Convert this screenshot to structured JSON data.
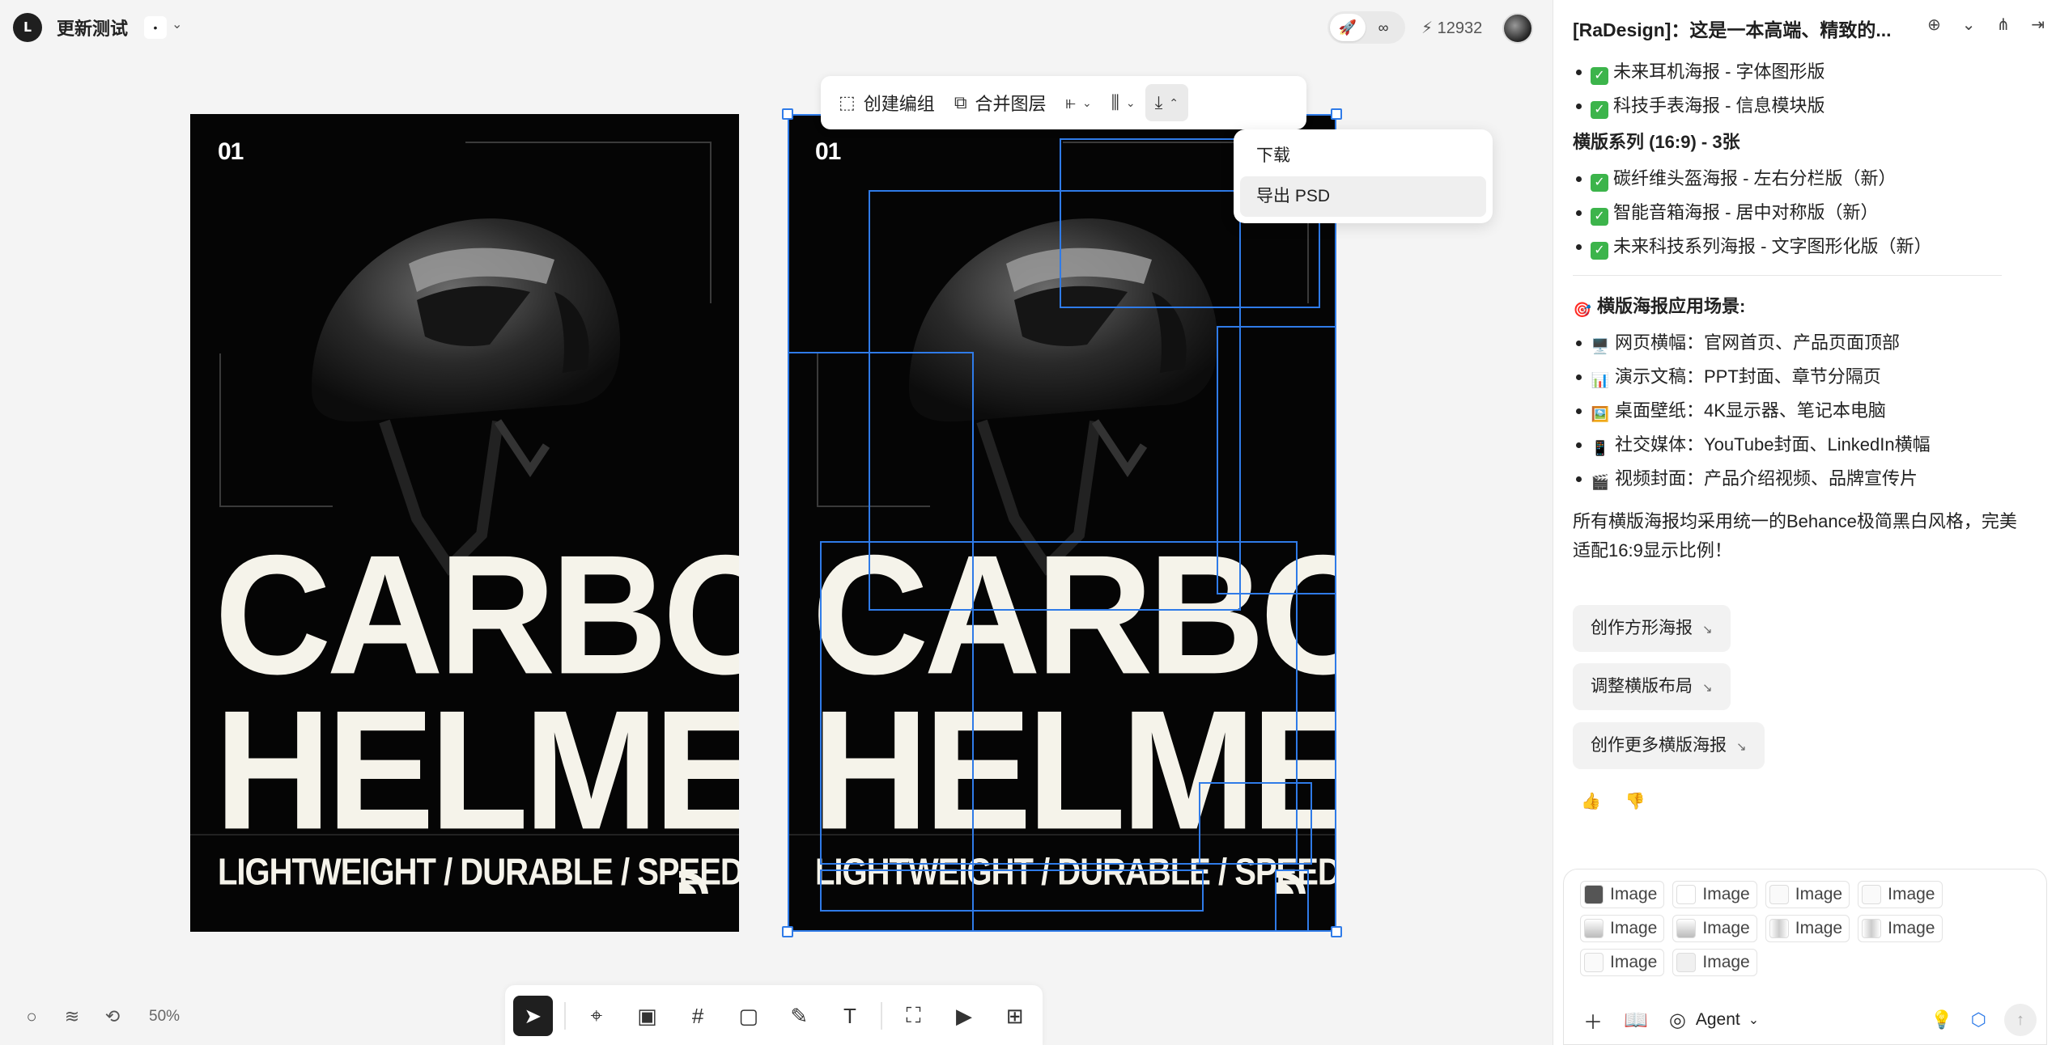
{
  "project": {
    "title": "更新测试",
    "badge": "•"
  },
  "topbar": {
    "credits": "12932",
    "mode_rocket": "🚀",
    "mode_infinity": "∞"
  },
  "floating_toolbar": {
    "create_group": "创建编组",
    "merge_layers": "合并图层"
  },
  "download_menu": {
    "download": "下载",
    "export_psd": "导出 PSD"
  },
  "zoom": "50%",
  "poster_left": {
    "number": "01",
    "line1": "CARBON",
    "line2": "HELMET",
    "tagline": "LIGHTWEIGHT / DURABLE / SPEED"
  },
  "poster_right": {
    "number": "01",
    "line1": "CARBON",
    "line2": "HELMET",
    "tagline": "LIGHTWEIGHT / DURABLE / SPEED"
  },
  "panel": {
    "title": "[RaDesign]：这是一本高端、精致的...",
    "items_a": [
      "未来耳机海报 - 字体图形版",
      "科技手表海报 - 信息模块版"
    ],
    "heading_landscape": "横版系列 (16:9) - 3张",
    "items_b": [
      "碳纤维头盔海报 - 左右分栏版（新）",
      "智能音箱海报 - 居中对称版（新）",
      "未来科技系列海报 - 文字图形化版（新）"
    ],
    "heading_scenes": "横版海报应用场景:",
    "scenes": [
      {
        "icon": "🖥️",
        "text": "网页横幅：官网首页、产品页面顶部"
      },
      {
        "icon": "📊",
        "text": "演示文稿：PPT封面、章节分隔页"
      },
      {
        "icon": "🖼️",
        "text": "桌面壁纸：4K显示器、笔记本电脑"
      },
      {
        "icon": "📱",
        "text": "社交媒体：YouTube封面、LinkedIn横幅"
      },
      {
        "icon": "🎬",
        "text": "视频封面：产品介绍视频、品牌宣传片"
      }
    ],
    "summary": "所有横版海报均采用统一的Behance极简黑白风格，完美适配16:9显示比例！",
    "suggestions": [
      "创作方形海报",
      "调整横版布局",
      "创作更多横版海报"
    ],
    "chips": [
      "Image",
      "Image",
      "Image",
      "Image",
      "Image",
      "Image",
      "Image",
      "Image",
      "Image",
      "Image"
    ],
    "agent_label": "Agent"
  },
  "colors": {
    "accent": "#2f7be8",
    "success": "#3cb44b",
    "poster_bg": "#050505",
    "poster_text": "#f5f3ea"
  }
}
